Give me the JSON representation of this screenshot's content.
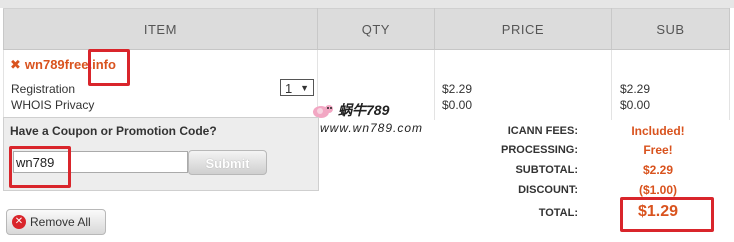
{
  "table": {
    "headers": [
      "ITEM",
      "QTY",
      "PRICE",
      "SUB"
    ]
  },
  "item": {
    "domain": "wn789free.info",
    "rows": [
      {
        "label": "Registration",
        "price": "$2.29",
        "sub": "$2.29"
      },
      {
        "label": "WHOIS Privacy",
        "price": "$0.00",
        "sub": "$0.00"
      }
    ],
    "qty": "1"
  },
  "coupon": {
    "title": "Have a Coupon or Promotion Code?",
    "value": "wn789",
    "submit_label": "Submit"
  },
  "remove_all_label": "Remove All",
  "summary": {
    "icann_label": "ICANN FEES:",
    "icann_value": "Included!",
    "processing_label": "PROCESSING:",
    "processing_value": "Free!",
    "subtotal_label": "SUBTOTAL:",
    "subtotal_value": "$2.29",
    "discount_label": "DISCOUNT:",
    "discount_value": "($1.00)",
    "total_label": "TOTAL:",
    "total_value": "$1.29"
  },
  "watermark": {
    "title": "蜗牛789",
    "url": "www.wn789.com"
  },
  "colors": {
    "accent": "#d9531e",
    "highlight": "#d9252b",
    "header_bg": "#dcdcdc",
    "panel_bg": "#ededed"
  },
  "icons": [
    "remove-x-icon",
    "remove-circle-icon",
    "chevron-down-icon",
    "snail-mascot-icon"
  ]
}
